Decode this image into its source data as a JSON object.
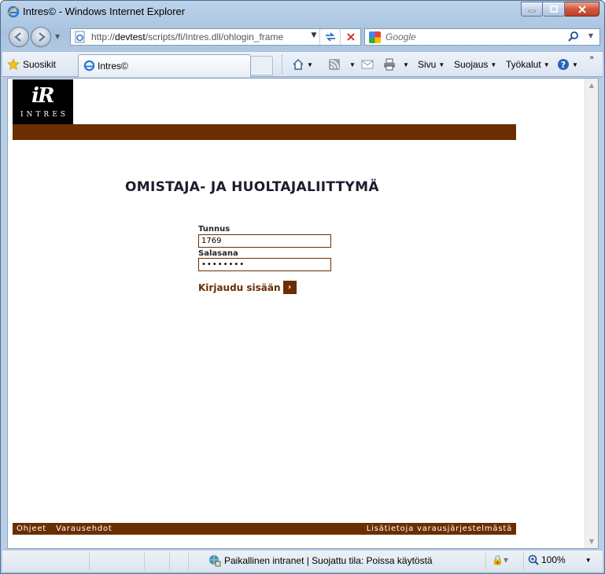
{
  "window": {
    "title": "Intres© - Windows Internet Explorer"
  },
  "addressbar": {
    "url_prefix": "http://",
    "url_host": "devtest",
    "url_path": "/scripts/fi/Intres.dll/ohlogin_frame",
    "search_placeholder": "Google"
  },
  "commandbar": {
    "favorites_label": "Suosikit",
    "tab_label": "Intres©",
    "page_menu": "Sivu",
    "safety_menu": "Suojaus",
    "tools_menu": "Työkalut"
  },
  "page": {
    "logo_text": "INTRES",
    "heading": "OMISTAJA- JA HUOLTAJALIITTYMÄ",
    "username_label": "Tunnus",
    "username_value": "1769",
    "password_label": "Salasana",
    "password_value": "••••••••",
    "login_label": "Kirjaudu sisään",
    "footer_links": [
      "Ohjeet",
      "Varausehdot"
    ],
    "footer_right": "Lisätietoja varausjärjestelmästä"
  },
  "statusbar": {
    "zone_text": "Paikallinen intranet | Suojattu tila: Poissa käytöstä",
    "zoom": "100%"
  },
  "colors": {
    "brand_brown": "#6b2e00",
    "heading": "#1c1c2e"
  }
}
